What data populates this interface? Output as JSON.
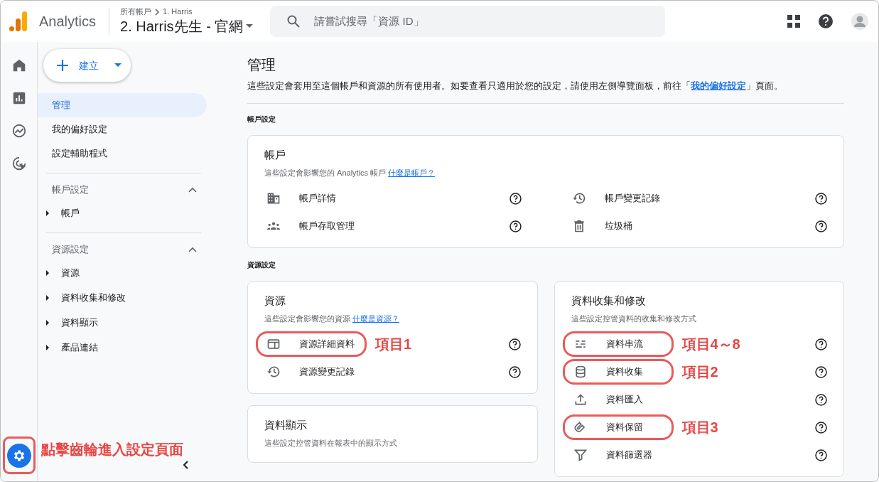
{
  "header": {
    "product": "Analytics",
    "breadcrumb": "所有帳戶",
    "breadcrumb_current": "1. Harris",
    "property": "2. Harris先生 - 官網",
    "search": {
      "placeholder": "請嘗試搜尋「資源 ID」"
    }
  },
  "rail": [
    {
      "kind": "home",
      "selected": false
    },
    {
      "kind": "reports",
      "selected": false
    },
    {
      "kind": "explore",
      "selected": false
    },
    {
      "kind": "advertising",
      "selected": false
    }
  ],
  "settings_button": {
    "selected": true,
    "circled": true,
    "callout": "點擊齒輪進入設定頁面"
  },
  "create_button": {
    "label": "建立"
  },
  "nav": {
    "items": [
      {
        "label": "管理",
        "selected": true
      },
      {
        "label": "我的偏好設定",
        "selected": false
      },
      {
        "label": "設定輔助程式",
        "selected": false
      }
    ],
    "sections": [
      {
        "title": "帳戶設定",
        "expanded": true,
        "children": [
          {
            "label": "帳戶",
            "expanded": false
          }
        ]
      },
      {
        "title": "資源設定",
        "expanded": true,
        "children": [
          {
            "label": "資源",
            "expanded": false
          },
          {
            "label": "資料收集和修改",
            "expanded": false
          },
          {
            "label": "資料顯示",
            "expanded": false
          },
          {
            "label": "產品連結",
            "expanded": false
          }
        ]
      }
    ]
  },
  "main": {
    "title": "管理",
    "description_before": "這些設定會套用至這個帳戶和資源的所有使用者。如要查看只適用於您的設定，請使用左側導覽面板，前往「",
    "description_link": "我的偏好設定",
    "description_after": "」頁面。",
    "account_settings": {
      "heading": "帳戶設定",
      "card": {
        "title": "帳戶",
        "description": "這些設定會影響您的 Analytics 帳戶",
        "link": "什麼是帳戶？",
        "items": [
          {
            "kind": "building",
            "label": "帳戶詳情",
            "circled": false
          },
          {
            "kind": "history",
            "label": "帳戶變更記錄",
            "circled": false
          },
          {
            "kind": "people",
            "label": "帳戶存取管理",
            "circled": false
          },
          {
            "kind": "trash",
            "label": "垃圾桶",
            "circled": false
          }
        ]
      }
    },
    "property_settings": {
      "heading": "資源設定",
      "columns": [
        {
          "cards": [
            {
              "title": "資源",
              "description": "這些設定會影響您的資源",
              "link": "什麼是資源？",
              "items": [
                {
                  "kind": "panel",
                  "label": "資源詳細資料",
                  "circled": true,
                  "callout": "項目1"
                },
                {
                  "kind": "history",
                  "label": "資源變更記錄",
                  "circled": false
                }
              ]
            },
            {
              "title": "資料顯示",
              "description": "這些設定控管資料在報表中的顯示方式"
            }
          ]
        },
        {
          "cards": [
            {
              "title": "資料收集和修改",
              "description": "這些設定控管資料的收集和修改方式",
              "items": [
                {
                  "kind": "streams",
                  "label": "資料串流",
                  "circled": true,
                  "callout": "項目4～8"
                },
                {
                  "kind": "database",
                  "label": "資料收集",
                  "circled": true,
                  "callout": "項目2"
                },
                {
                  "kind": "upload",
                  "label": "資料匯入",
                  "circled": false
                },
                {
                  "kind": "magnet",
                  "label": "資料保留",
                  "circled": true,
                  "callout": "項目3"
                },
                {
                  "kind": "filter",
                  "label": "資料篩選器",
                  "circled": false
                }
              ]
            }
          ]
        }
      ]
    }
  }
}
